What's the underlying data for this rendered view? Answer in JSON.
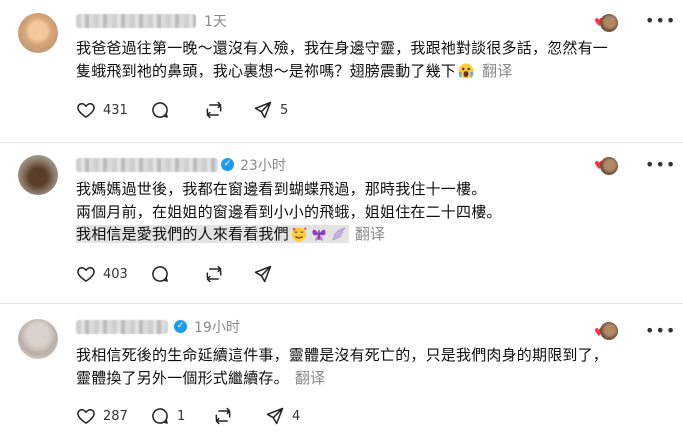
{
  "comments": [
    {
      "time": "1天",
      "lines": [
        "我爸爸過往第一晚～還沒有入殮，我在身邊守靈，我跟祂對談很多話，忽然有一",
        "隻蛾飛到祂的鼻頭，我心裏想～是祢嗎？翅膀震動了幾下"
      ],
      "translate": "翻译",
      "likes": "431",
      "reposts": "5",
      "emoji": "face-screaming-emoji"
    },
    {
      "time": "23小时",
      "lines": [
        "我媽媽過世後，我都在窗邊看到蝴蝶飛過，那時我住十一樓。",
        "兩個月前，在姐姐的窗邊看到小小的飛蛾，姐姐住在二十四樓。",
        "我相信是愛我們的人來看看我們"
      ],
      "translate": "翻译",
      "likes": "403"
    },
    {
      "time": "19小时",
      "lines": [
        "我相信死後的生命延續這件事，靈體是沒有死亡的，只是我們肉身的期限到了，",
        "靈體換了另外一個形式繼續存。"
      ],
      "translate": "翻译",
      "likes": "287",
      "replies": "1",
      "reposts": "4"
    }
  ],
  "icons": {
    "like": "heart-icon",
    "reply": "comment-icon",
    "repost": "repost-icon",
    "more": "more-options-icon",
    "verified": "verified-badge-icon"
  },
  "colors": {
    "accent_blue": "#1d9bf0",
    "muted": "#8a8a8a",
    "heart": "#ff3040"
  }
}
